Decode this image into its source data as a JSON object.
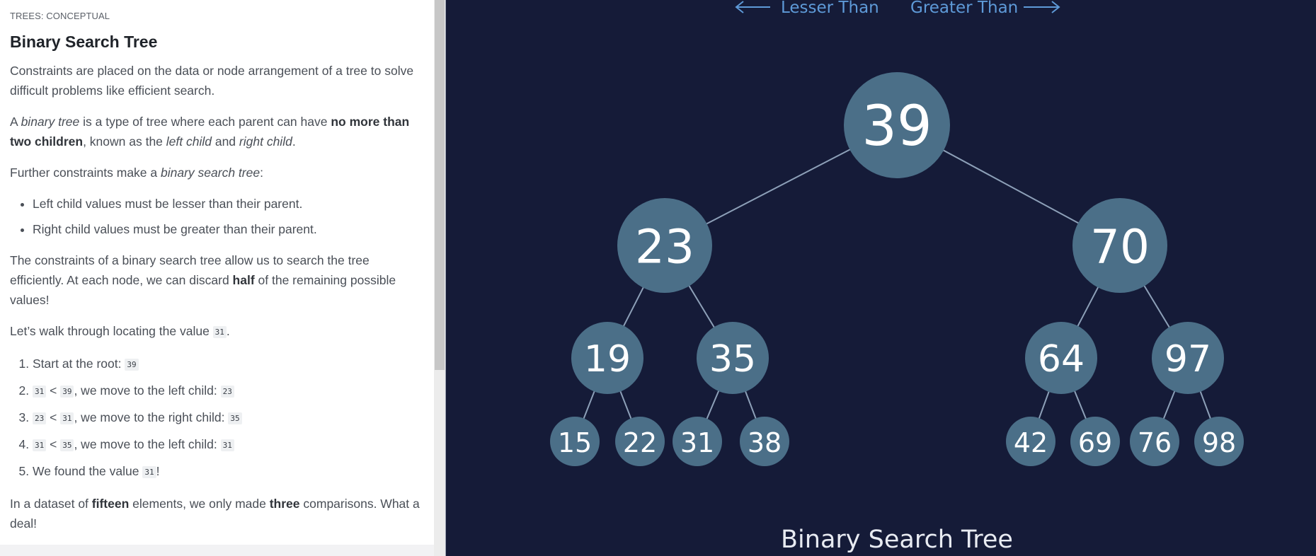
{
  "lesson": {
    "eyebrow": "TREES: CONCEPTUAL",
    "title": "Binary Search Tree",
    "intro": "Constraints are placed on the data or node arrangement of a tree to solve difficult problems like efficient search.",
    "bt_def": {
      "t1": "A ",
      "i1": "binary tree",
      "t2": " is a type of tree where each parent can have ",
      "b1": "no more than two children",
      "t3": ", known as the ",
      "i2": "left child",
      "t4": " and ",
      "i3": "right child",
      "t5": "."
    },
    "further": {
      "t1": "Further constraints make a ",
      "i1": "binary search tree",
      "t2": ":"
    },
    "rules": [
      "Left child values must be lesser than their parent.",
      "Right child values must be greater than their parent."
    ],
    "efficiency": {
      "t1": "The constraints of a binary search tree allow us to search the tree efficiently. At each node, we can discard ",
      "b1": "half",
      "t2": " of the remaining possible values!"
    },
    "walk": {
      "t1": "Let’s walk through locating the value ",
      "c1": "31",
      "t2": "."
    },
    "steps": [
      {
        "t1": "Start at the root: ",
        "c1": "39"
      },
      {
        "c1": "31",
        "t1": " < ",
        "c2": "39",
        "t2": ", we move to the left child: ",
        "c3": "23"
      },
      {
        "c1": "23",
        "t1": " < ",
        "c2": "31",
        "t2": ", we move to the right child: ",
        "c3": "35"
      },
      {
        "c1": "31",
        "t1": " < ",
        "c2": "35",
        "t2": ", we move to the left child: ",
        "c3": "31"
      },
      {
        "t1": "We found the value ",
        "c1": "31",
        "t2": "!"
      }
    ],
    "summary": {
      "t1": "In a dataset of ",
      "b1": "fifteen",
      "t2": " elements, we only made ",
      "b2": "three",
      "t3": " comparisons. What a deal!"
    }
  },
  "diagram": {
    "legend_left": "Lesser Than",
    "legend_right": "Greater Than",
    "caption": "Binary Search Tree",
    "colors": {
      "background": "#151b38",
      "node": "#4b6f88",
      "edge": "#8da0b8",
      "legend": "#5e9ad8",
      "text": "#ffffff"
    },
    "tree": {
      "root": "39",
      "level2": [
        "23",
        "70"
      ],
      "level3": [
        "19",
        "35",
        "64",
        "97"
      ],
      "level4": [
        "15",
        "22",
        "31",
        "38",
        "42",
        "69",
        "76",
        "98"
      ]
    }
  }
}
